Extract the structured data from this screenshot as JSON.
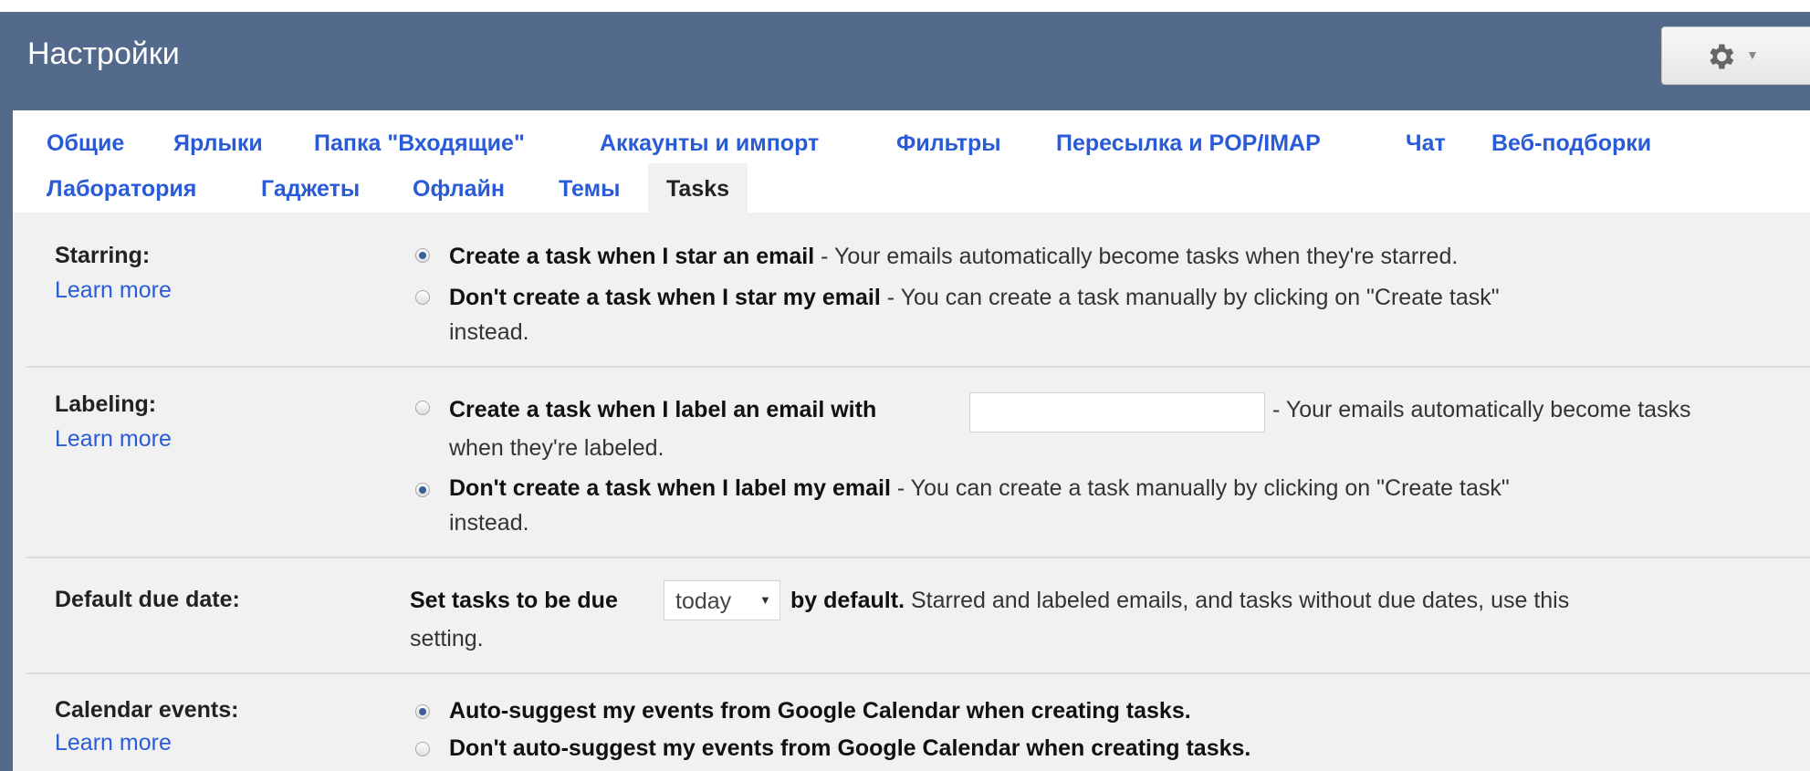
{
  "header": {
    "title": "Настройки"
  },
  "tabs": [
    "Общие",
    "Ярлыки",
    "Папка \"Входящие\"",
    "Аккаунты и импорт",
    "Фильтры",
    "Пересылка и POP/IMAP",
    "Чат",
    "Веб-подборки",
    "Лаборатория",
    "Гаджеты",
    "Офлайн",
    "Темы",
    "Tasks"
  ],
  "active_tab": "Tasks",
  "starring": {
    "label": "Starring:",
    "learn_more": "Learn more",
    "option1_bold": "Create a task when I star an email",
    "option1_rest": " - Your emails automatically become tasks when they're starred.",
    "option2_bold": "Don't create a task when I star my email",
    "option2_rest": " - You can create a task manually by clicking on \"Create task\"",
    "option2_cont": "instead.",
    "selected": 1
  },
  "labeling": {
    "label": "Labeling:",
    "learn_more": "Learn more",
    "option1_bold": "Create a task when I label an email with",
    "option1_rest": "- Your emails automatically become tasks",
    "option1_cont": "when they're labeled.",
    "input_value": "",
    "option2_bold": "Don't create a task when I label my email",
    "option2_rest": " - You can create a task manually by clicking on \"Create task\"",
    "option2_cont": "instead.",
    "selected": 2
  },
  "due_date": {
    "label": "Default due date:",
    "pre_bold": "Set tasks to be due",
    "select_value": "today",
    "post_bold": "by default.",
    "post_rest": " Starred and labeled emails, and tasks without due dates, use this",
    "cont": "setting."
  },
  "calendar": {
    "label": "Calendar events:",
    "learn_more": "Learn more",
    "option1": "Auto-suggest my events from Google Calendar when creating tasks.",
    "option2": "Don't auto-suggest my events from Google Calendar when creating tasks.",
    "selected": 1
  },
  "icons": {
    "settings": "gear-icon",
    "dropdown": "caret-down-icon"
  },
  "colors": {
    "header_bg": "#536a8c",
    "link": "#2a5bd7",
    "panel_bg": "#f1f1f1"
  }
}
